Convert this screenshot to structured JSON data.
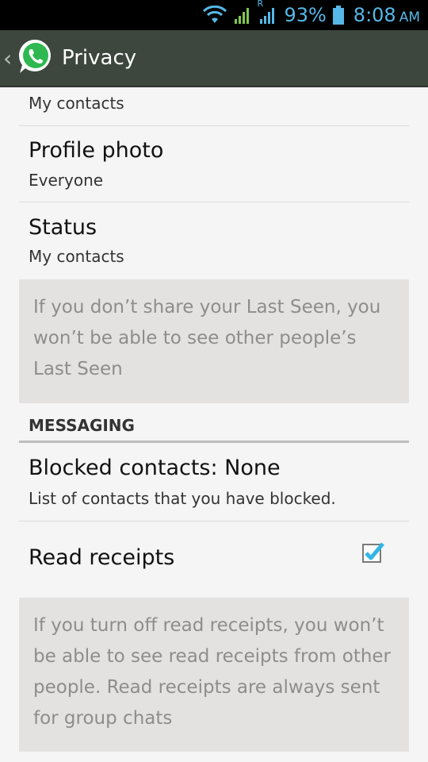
{
  "status_bar": {
    "signal_roaming_label": "R",
    "battery": "93%",
    "time": "8:08",
    "ampm": "AM",
    "color": "#55b8e8"
  },
  "header": {
    "back_glyph": "‹",
    "title": "Privacy",
    "logo_icon": "whatsapp-logo",
    "background": "#3d473d"
  },
  "rows": {
    "last_seen_value": "My contacts",
    "profile_photo": {
      "title": "Profile photo",
      "value": "Everyone"
    },
    "status": {
      "title": "Status",
      "value": "My contacts"
    }
  },
  "info_last_seen": {
    "lines": [
      "If you don’t share your Last Seen, you",
      "won’t be able to see other people’s",
      "Last Seen"
    ]
  },
  "messaging": {
    "header": "MESSAGING",
    "blocked": {
      "title": "Blocked contacts: None",
      "subtitle": "List of contacts that you have blocked."
    },
    "read_receipts": {
      "title": "Read receipts",
      "checked": true,
      "check_color": "#33b5e5"
    }
  },
  "info_read_receipts": {
    "lines": [
      "If you turn off read receipts, you won’t",
      "be able to see read receipts from other",
      "people. Read receipts are always sent",
      "for group chats"
    ]
  }
}
